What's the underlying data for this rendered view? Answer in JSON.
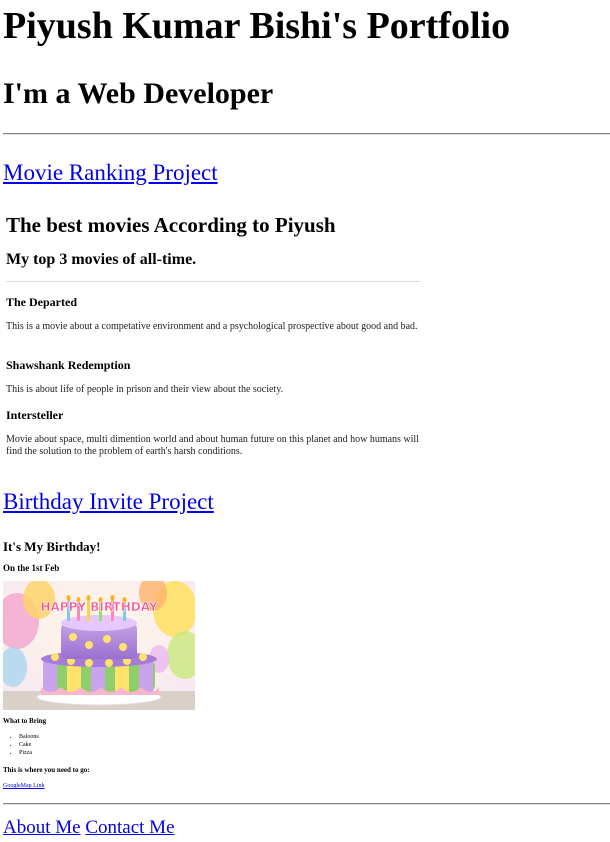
{
  "header": {
    "title": "Piyush Kumar Bishi's Portfolio",
    "subtitle": "I'm a Web Developer"
  },
  "projects": {
    "movie_link": "Movie Ranking Project",
    "birthday_link": "Birthday Invite Project"
  },
  "movie_ranking": {
    "heading": "The best movies According to Piyush",
    "subheading": "My top 3 movies of all-time.",
    "movies": [
      {
        "title": "The Departed",
        "description": "This is a movie about a competative environment and a psychological prospective about good and bad."
      },
      {
        "title": "Shawshank Redemption",
        "description": "This is about life of people in prison and their view about the society."
      },
      {
        "title": "Intersteller",
        "description": "Movie about space, multi dimention world and about human future on this planet and how humans will find the solution to the problem of earth's harsh conditions."
      }
    ]
  },
  "birthday": {
    "heading": "It's My Birthday!",
    "date": "On the 1st Feb",
    "image_text": "HAPPY BIRTHDAY",
    "bring_title": "What to Bring",
    "bring_items": [
      "Baloons",
      "Cake",
      "Pizza"
    ],
    "where_title": "This is where you need to go:",
    "map_link": "GoogleMap Link"
  },
  "footer": {
    "about": "About Me",
    "contact": "Contact Me"
  },
  "colors": {
    "link": "#0000ee",
    "text": "#000000",
    "background": "#ffffff"
  }
}
